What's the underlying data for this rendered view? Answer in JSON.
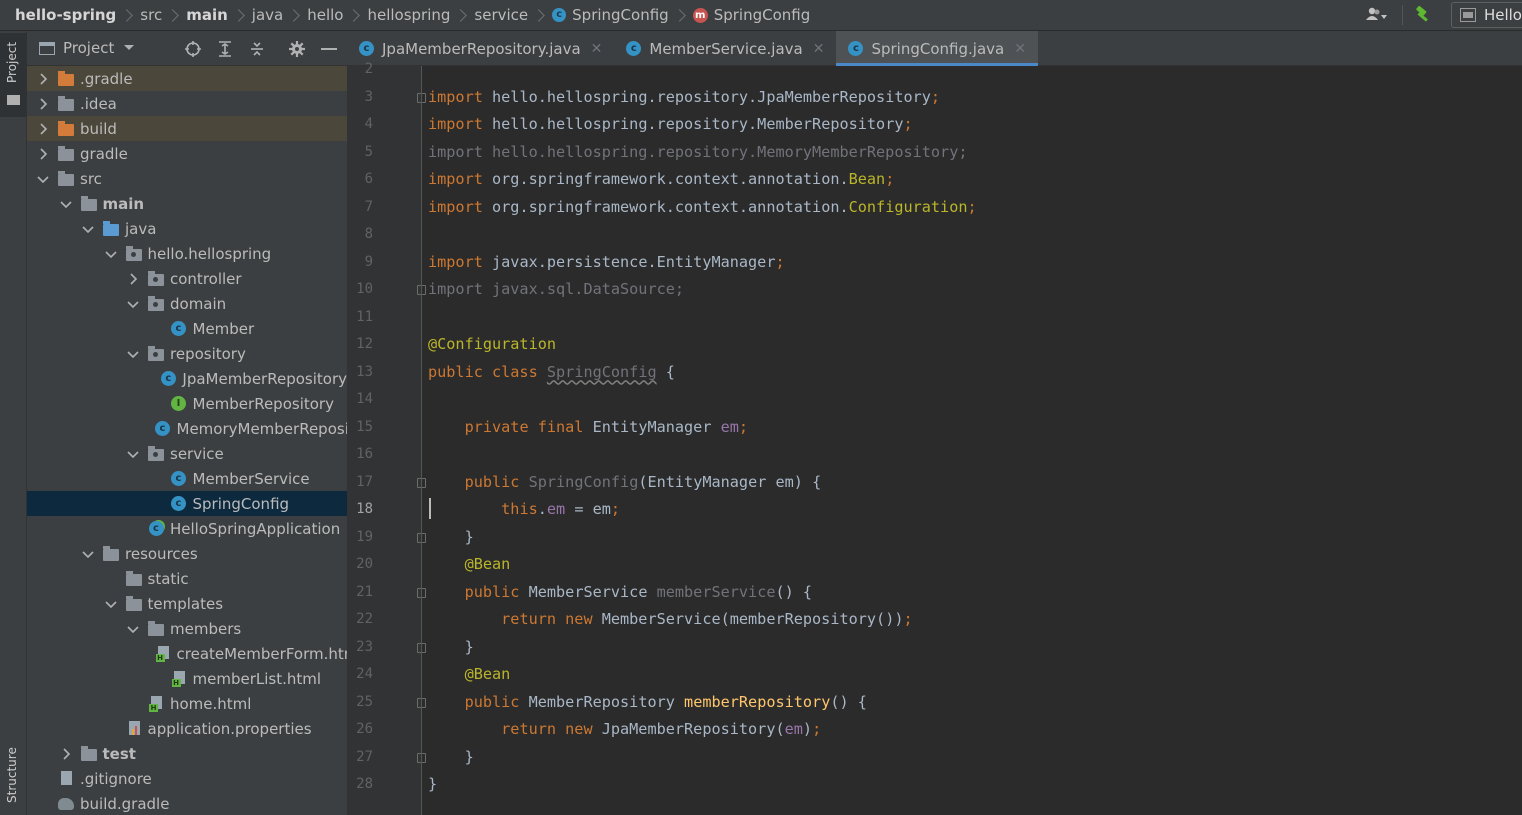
{
  "breadcrumb": {
    "items": [
      {
        "label": "hello-spring",
        "strong": true
      },
      {
        "label": "src"
      },
      {
        "label": "main",
        "strong": true
      },
      {
        "label": "java"
      },
      {
        "label": "hello"
      },
      {
        "label": "hellospring"
      },
      {
        "label": "service"
      },
      {
        "label": "SpringConfig",
        "icon": "class-icon"
      },
      {
        "label": "SpringConfig",
        "icon": "configuration-icon"
      }
    ]
  },
  "toolbar": {
    "run_config_label": "Hello"
  },
  "left_strip": {
    "project_label": "Project",
    "structure_label": "Structure"
  },
  "project_panel": {
    "title": "Project",
    "tree": [
      {
        "label": ".gradle",
        "icon": "folder-orange-icon",
        "arrow": "right",
        "excluded": true
      },
      {
        "label": ".idea",
        "icon": "folder-icon",
        "arrow": "right"
      },
      {
        "label": "build",
        "icon": "folder-orange-icon",
        "arrow": "right",
        "excluded": true
      },
      {
        "label": "gradle",
        "icon": "folder-icon",
        "arrow": "right"
      },
      {
        "label": "src",
        "icon": "folder-icon",
        "arrow": "down"
      },
      {
        "label": "main",
        "icon": "source-folder-icon",
        "arrow": "down",
        "bold": true
      },
      {
        "label": "java",
        "icon": "source-root-icon",
        "arrow": "down"
      },
      {
        "label": "hello.hellospring",
        "icon": "package-icon",
        "arrow": "down"
      },
      {
        "label": "controller",
        "icon": "package-icon",
        "arrow": "right"
      },
      {
        "label": "domain",
        "icon": "package-icon",
        "arrow": "down"
      },
      {
        "label": "Member",
        "icon": "class-icon"
      },
      {
        "label": "repository",
        "icon": "package-icon",
        "arrow": "down"
      },
      {
        "label": "JpaMemberRepository",
        "icon": "class-icon"
      },
      {
        "label": "MemberRepository",
        "icon": "interface-icon"
      },
      {
        "label": "MemoryMemberRepository",
        "icon": "class-icon"
      },
      {
        "label": "service",
        "icon": "package-icon",
        "arrow": "down"
      },
      {
        "label": "MemberService",
        "icon": "class-icon"
      },
      {
        "label": "SpringConfig",
        "icon": "class-icon",
        "selected": true
      },
      {
        "label": "HelloSpringApplication",
        "icon": "spring-boot-class-icon"
      },
      {
        "label": "resources",
        "icon": "resources-folder-icon",
        "arrow": "down"
      },
      {
        "label": "static",
        "icon": "folder-icon"
      },
      {
        "label": "templates",
        "icon": "folder-icon",
        "arrow": "down"
      },
      {
        "label": "members",
        "icon": "folder-icon",
        "arrow": "down"
      },
      {
        "label": "createMemberForm.html",
        "icon": "html-file-icon"
      },
      {
        "label": "memberList.html",
        "icon": "html-file-icon"
      },
      {
        "label": "home.html",
        "icon": "html-file-icon"
      },
      {
        "label": "application.properties",
        "icon": "properties-file-icon"
      },
      {
        "label": "test",
        "icon": "test-folder-icon",
        "arrow": "right",
        "bold": true
      },
      {
        "label": ".gitignore",
        "icon": "gitignore-file-icon"
      },
      {
        "label": "build.gradle",
        "icon": "gradle-file-icon"
      }
    ]
  },
  "tabs": [
    {
      "label": "JpaMemberRepository.java",
      "active": false
    },
    {
      "label": "MemberService.java",
      "active": false
    },
    {
      "label": "SpringConfig.java",
      "active": true
    }
  ],
  "editor": {
    "current_line": 18,
    "lines": [
      {
        "n": 2,
        "text": ""
      },
      {
        "n": 3,
        "text": "import hello.hellospring.repository.JpaMemberRepository;"
      },
      {
        "n": 4,
        "text": "import hello.hellospring.repository.MemberRepository;"
      },
      {
        "n": 5,
        "text": "import hello.hellospring.repository.MemoryMemberRepository;"
      },
      {
        "n": 6,
        "text": "import org.springframework.context.annotation.Bean;"
      },
      {
        "n": 7,
        "text": "import org.springframework.context.annotation.Configuration;"
      },
      {
        "n": 8,
        "text": ""
      },
      {
        "n": 9,
        "text": "import javax.persistence.EntityManager;"
      },
      {
        "n": 10,
        "text": "import javax.sql.DataSource;"
      },
      {
        "n": 11,
        "text": ""
      },
      {
        "n": 12,
        "text": "@Configuration"
      },
      {
        "n": 13,
        "text": "public class SpringConfig {"
      },
      {
        "n": 14,
        "text": ""
      },
      {
        "n": 15,
        "text": "    private final EntityManager em;"
      },
      {
        "n": 16,
        "text": ""
      },
      {
        "n": 17,
        "text": "    public SpringConfig(EntityManager em) {"
      },
      {
        "n": 18,
        "text": "        this.em = em;"
      },
      {
        "n": 19,
        "text": "    }"
      },
      {
        "n": 20,
        "text": "    @Bean"
      },
      {
        "n": 21,
        "text": "    public MemberService memberService() {"
      },
      {
        "n": 22,
        "text": "        return new MemberService(memberRepository());"
      },
      {
        "n": 23,
        "text": "    }"
      },
      {
        "n": 24,
        "text": "    @Bean"
      },
      {
        "n": 25,
        "text": "    public MemberRepository memberRepository() {"
      },
      {
        "n": 26,
        "text": "        return new JpaMemberRepository(em);"
      },
      {
        "n": 27,
        "text": "    }"
      },
      {
        "n": 28,
        "text": "}"
      }
    ]
  },
  "colors": {
    "keyword": "#cc7832",
    "annotation": "#bbb529",
    "field": "#9876aa",
    "method_decl": "#ffc66d",
    "default_text": "#a9b7c6",
    "unused": "#72737a",
    "selection": "#0d293e",
    "accent": "#4a88c7"
  }
}
